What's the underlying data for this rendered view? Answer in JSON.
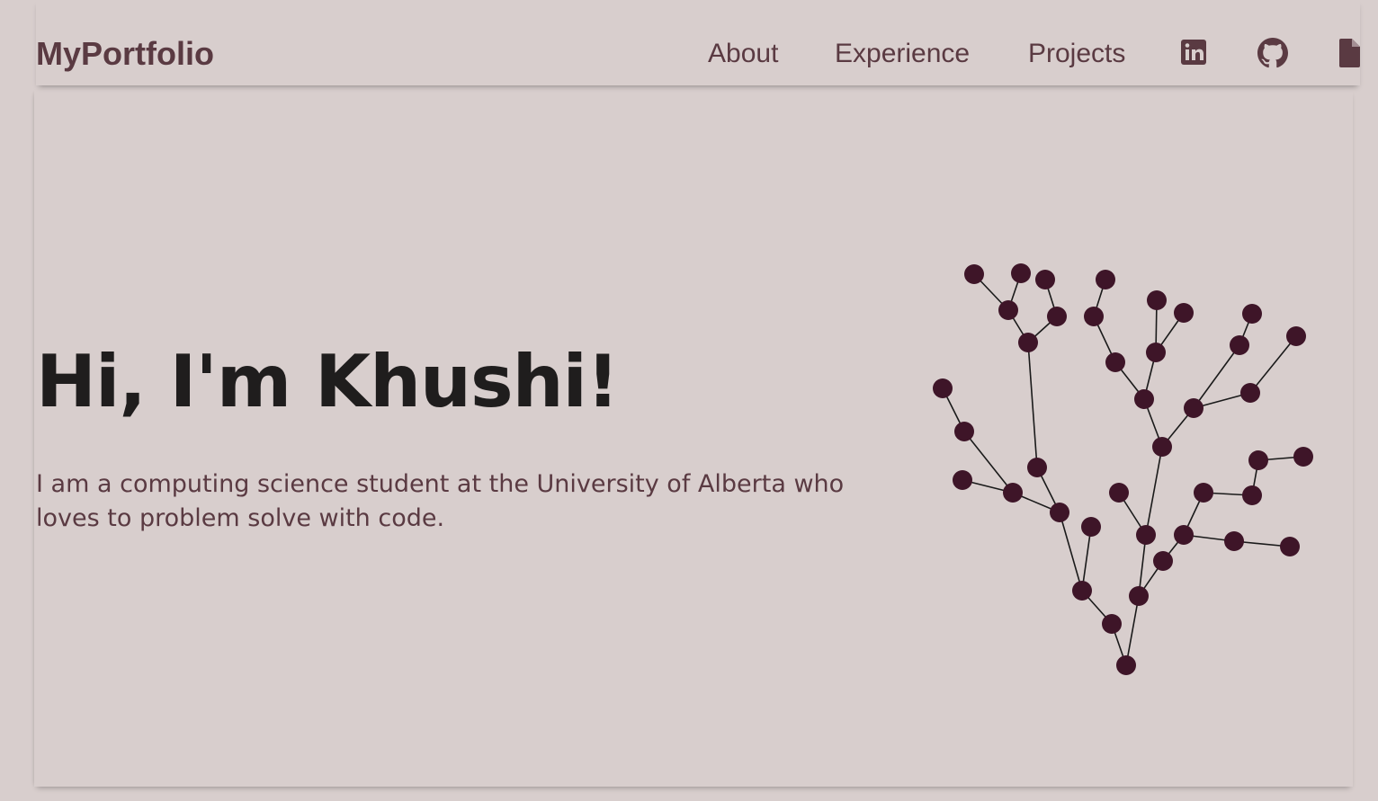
{
  "header": {
    "logo": "MyPortfolio",
    "nav": [
      {
        "label": "About"
      },
      {
        "label": "Experience"
      },
      {
        "label": "Projects"
      }
    ],
    "icons": [
      "linkedin-icon",
      "github-icon",
      "resume-file-icon"
    ]
  },
  "hero": {
    "title": "Hi, I'm Khushi!",
    "subtitle": "I am a computing science student at the University of Alberta who loves to problem solve with code."
  },
  "colors": {
    "background": "#d8cecd",
    "accent": "#5a3a42",
    "heading": "#1f1d1d",
    "tree_node": "#3e1528",
    "tree_edge": "#1a1a1a"
  }
}
